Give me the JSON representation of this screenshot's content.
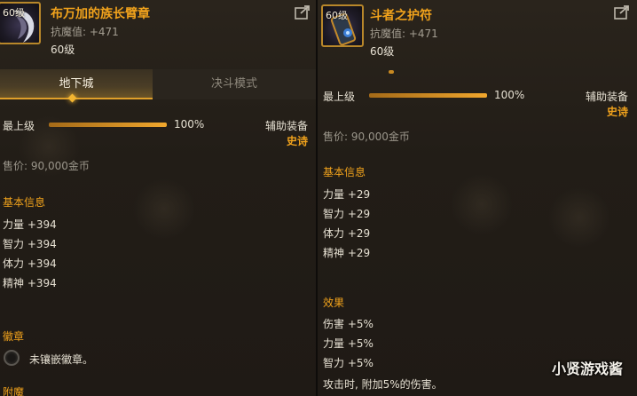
{
  "left": {
    "item": {
      "level_badge": "60级",
      "name": "布万加的族长臂章",
      "stat_line": "抗魔值: +471",
      "level": "60级"
    },
    "tabs": [
      {
        "label": "地下城",
        "active": true
      },
      {
        "label": "决斗模式",
        "active": false
      }
    ],
    "max_level": {
      "label": "最上级",
      "percent": "100%",
      "fill": 1.0
    },
    "slot_type": "辅助装备",
    "rarity": "史诗",
    "price": "售价: 90,000金币",
    "basic_info": {
      "title": "基本信息",
      "stats": [
        "力量 +394",
        "智力 +394",
        "体力 +394",
        "精神 +394"
      ]
    },
    "emblem": {
      "title": "徽章",
      "text": "未镶嵌徽章。"
    },
    "enchant": {
      "title": "附魔"
    }
  },
  "right": {
    "item": {
      "level_badge": "60级",
      "name": "斗者之护符",
      "stat_line": "抗魔值: +471",
      "level": "60级"
    },
    "max_level": {
      "label": "最上级",
      "percent": "100%",
      "fill": 1.0
    },
    "slot_type": "辅助装备",
    "rarity": "史诗",
    "price": "售价: 90,000金币",
    "basic_info": {
      "title": "基本信息",
      "stats": [
        "力量 +29",
        "智力 +29",
        "体力 +29",
        "精神 +29"
      ]
    },
    "effects": {
      "title": "效果",
      "lines": [
        "伤害 +5%",
        "力量 +5%",
        "智力 +5%",
        "攻击时, 附加5%的伤害。"
      ]
    }
  },
  "watermark": "小贤游戏酱",
  "colors": {
    "accent": "#f0a21c",
    "text": "#e6e0d2",
    "muted": "#9a958a",
    "background": "#221d17"
  }
}
